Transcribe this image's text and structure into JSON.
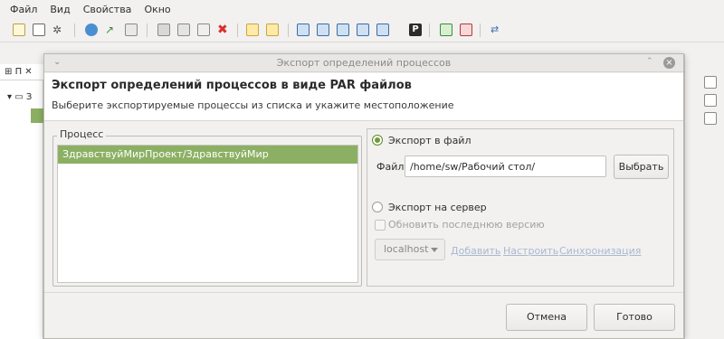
{
  "menu": [
    "Файл",
    "Вид",
    "Свойства",
    "Окно"
  ],
  "background": {
    "left_tab_label": "П",
    "tree_label": "З"
  },
  "dialog": {
    "window_title": "Экспорт определений процессов",
    "header_title": "Экспорт определений процессов в виде PAR файлов",
    "header_subtitle": "Выберите экспортируемые процессы из списка и укажите местоположение",
    "process_group_label": "Процесс",
    "processes": [
      "ЗдравствуйМирПроект/ЗдравствуйМир"
    ],
    "export_to_file_label": "Экспорт в файл",
    "export_to_file_selected": true,
    "file_label": "Файл",
    "file_path": "/home/sw/Рабочий стол/",
    "browse_button": "Выбрать",
    "export_to_server_label": "Экспорт на сервер",
    "export_to_server_selected": false,
    "update_latest_label": "Обновить последнюю версию",
    "server_combo_value": "localhost",
    "links": [
      "Добавить",
      "Настроить",
      "Синхронизация"
    ],
    "cancel_button": "Отмена",
    "ok_button": "Готово"
  },
  "colors": {
    "selection": "#8cb063",
    "accent_radio": "#6d9c34",
    "disabled_link": "#a9b8cf"
  }
}
